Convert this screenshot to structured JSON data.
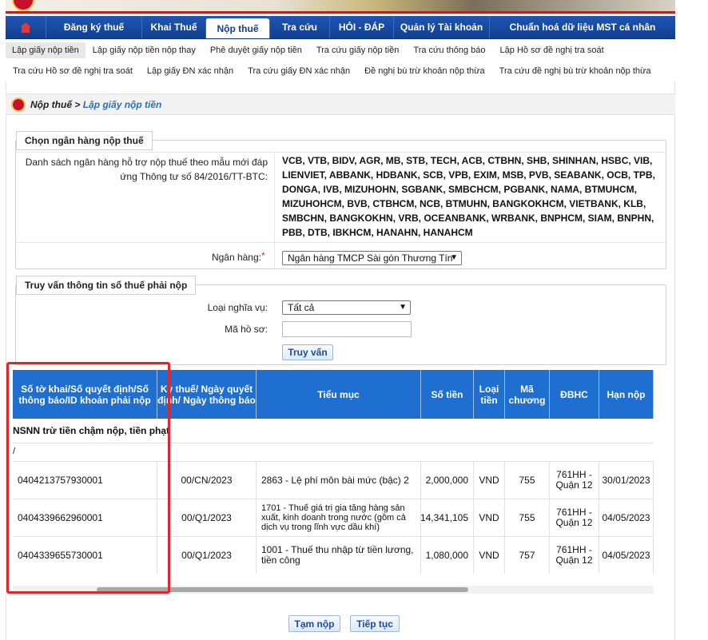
{
  "nav": {
    "items": [
      "Đăng ký thuế",
      "Khai Thuế",
      "Nộp thuế",
      "Tra cứu",
      "HỎI - ĐÁP",
      "Quản lý Tài khoản",
      "Chuẩn hoá dữ liệu MST cá nhân"
    ],
    "active": "Nộp thuế"
  },
  "subnav": {
    "row1": [
      "Lập giấy nộp tiền",
      "Lập giấy nộp tiền nộp thay",
      "Phê duyệt giấy nộp tiền",
      "Tra cứu giấy nộp tiền",
      "Tra cứu thông báo",
      "Lập Hồ sơ đề nghị tra soát"
    ],
    "row2": [
      "Tra cứu Hồ sơ đề nghị tra soát",
      "Lập giấy ĐN xác nhận",
      "Tra cứu giấy ĐN xác nhận",
      "Đề nghị bù trừ khoản nộp thừa",
      "Tra cứu đề nghị bù trừ khoản nộp thừa"
    ]
  },
  "breadcrumb": {
    "parent": "Nộp thuế",
    "separator": " > ",
    "current": "Lập giấy nộp tiền"
  },
  "bank_section": {
    "legend": "Chọn ngân hàng nộp thuế",
    "list_label": "Danh sách ngân hàng hỗ trợ nộp thuế theo mẫu mới đáp ứng Thông tư số 84/2016/TT-BTC:",
    "banks": "VCB, VTB, BIDV, AGR, MB, STB, TECH, ACB, CTBHN, SHB, SHINHAN, HSBC, VIB, LIENVIET, ABBANK, HDBANK, SCB, VPB, EXIM, MSB, PVB, SEABANK, OCB, TPB, DONGA, IVB, MIZUHOHN, SGBANK, SMBCHCM, PGBANK, NAMA, BTMUHCM, MIZUHOHCM, BVB, CTBHCM, NCB, BTMUHN, BANGKOKHCM, VIETBANK, KLB, SMBCHN, BANGKOKHN, VRB, OCEANBANK, WRBANK, BNPHCM, SIAM, BNPHN, PBB, DTB, IBKHCM, HANAHN, HANAHCM",
    "bank_label": "Ngân hàng:",
    "required_mark": "*",
    "bank_value": "Ngân hàng TMCP Sài gòn Thương Tín"
  },
  "query_section": {
    "legend": "Truy vấn thông tin số thuế phải nộp",
    "type_label": "Loại nghĩa vụ:",
    "type_value": "Tất cả",
    "record_label": "Mã hồ sơ:",
    "record_value": "",
    "query_button": "Truy vấn"
  },
  "table": {
    "headers": [
      "Số tờ khai/Số quyết định/Số thông báo/ID khoản phải nộp",
      "Kỳ thuế/ Ngày quyết định/ Ngày thông báo",
      "Tiểu mục",
      "Số tiền",
      "Loại tiền",
      "Mã chương",
      "ĐBHC",
      "Hạn nộp"
    ],
    "group_label": "NSNN trừ tiền chậm nộp, tiền phạt",
    "group_sub": "/",
    "rows": [
      {
        "id": "0404213757930001",
        "period": "00/CN/2023",
        "item": "2863 - Lệ phí môn bài mức (bậc) 2",
        "amount": "2,000,000",
        "currency": "VND",
        "chapter": "755",
        "area": "761HH - Quận 12",
        "due": "30/01/2023"
      },
      {
        "id": "0404339662960001",
        "period": "00/Q1/2023",
        "item": "1701 - Thuế giá trị gia tăng hàng sản xuất, kinh doanh trong nước (gồm cả dịch vụ trong lĩnh vực dầu khí)",
        "amount": "14,341,105",
        "currency": "VND",
        "chapter": "755",
        "area": "761HH - Quận 12",
        "due": "04/05/2023"
      },
      {
        "id": "0404339655730001",
        "period": "00/Q1/2023",
        "item": "1001 - Thuế thu nhập từ tiền lương, tiền công",
        "amount": "1,080,000",
        "currency": "VND",
        "chapter": "757",
        "area": "761HH - Quận 12",
        "due": "04/05/2023"
      }
    ]
  },
  "footer": {
    "save_draft": "Tạm nộp",
    "continue": "Tiếp tục"
  },
  "colors": {
    "nav": "#103f8f",
    "table_header": "#1f6fd0",
    "highlight": "#e3242b",
    "link": "#2a6fb8"
  }
}
